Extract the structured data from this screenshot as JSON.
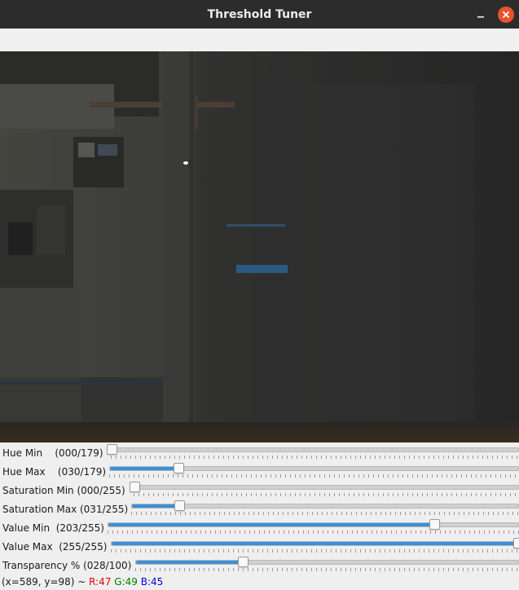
{
  "window": {
    "title": "Threshold Tuner",
    "minimize_icon": "minimize-icon",
    "close_icon": "close-icon",
    "close_color": "#e9542a"
  },
  "preview": {
    "description_icon": "camera-frame"
  },
  "sliders": [
    {
      "label": "Hue Min    (000/179)",
      "value": 0,
      "max": 179
    },
    {
      "label": "Hue Max    (030/179)",
      "value": 30,
      "max": 179
    },
    {
      "label": "Saturation Min (000/255)",
      "value": 0,
      "max": 255
    },
    {
      "label": "Saturation Max (031/255)",
      "value": 31,
      "max": 255
    },
    {
      "label": "Value Min  (203/255)",
      "value": 203,
      "max": 255
    },
    {
      "label": "Value Max  (255/255)",
      "value": 255,
      "max": 255
    },
    {
      "label": "Transparency % (028/100)",
      "value": 28,
      "max": 100
    }
  ],
  "status": {
    "coords": "(x=589, y=98) ~ ",
    "r": "R:47",
    "g": "G:49",
    "b": "B:45",
    "r_color": "#e00000",
    "g_color": "#008000",
    "b_color": "#0000e0"
  },
  "colors": {
    "accent": "#3d8fd6"
  }
}
